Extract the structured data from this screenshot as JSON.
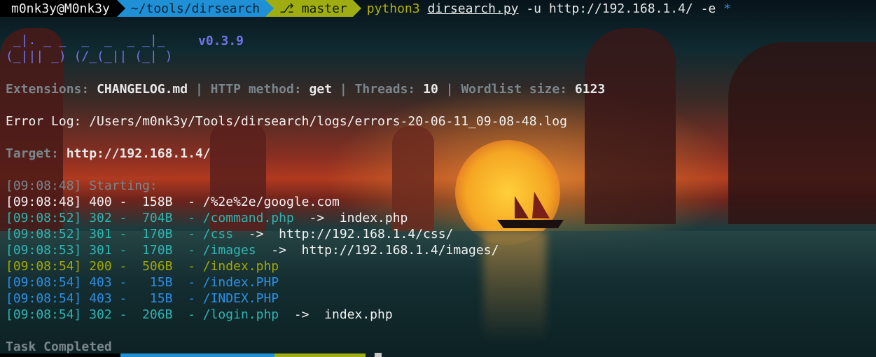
{
  "prompt": {
    "user_host": "m0nk3y@M0nk3y",
    "directory": "~/tools/dirsearch",
    "git_branch": "master",
    "cmd_python": "python3",
    "cmd_script": "dirsearch.py",
    "cmd_args": "-u http://192.168.1.4/ -e",
    "cmd_star": "*"
  },
  "banner": {
    "ascii_line1": " _|. _ _  _  _  _ _|_",
    "ascii_line2": "(_||| _) (/_(_|| (_| )",
    "version": "v0.3.9"
  },
  "config": {
    "ext_label": "Extensions:",
    "ext_value": "CHANGELOG.md",
    "method_label": "HTTP method:",
    "method_value": "get",
    "threads_label": "Threads:",
    "threads_value": "10",
    "wordlist_label": "Wordlist size:",
    "wordlist_value": "6123",
    "separator": "|"
  },
  "error_log": "Error Log: /Users/m0nk3y/Tools/dirsearch/logs/errors-20-06-11_09-08-48.log",
  "target": {
    "label": "Target:",
    "value": "http://192.168.1.4/"
  },
  "starting": "[09:08:48] Starting:",
  "results": [
    {
      "line": "[09:08:48] 400 -  158B  - /%2e%2e/google.com",
      "redirect": "",
      "color": "#f2f2f2"
    },
    {
      "line": "[09:08:52] 302 -  704B  - /command.php",
      "redirect": "  ->  index.php",
      "color": "#2eb5b2"
    },
    {
      "line": "[09:08:52] 301 -  170B  - /css",
      "redirect": "  ->  http://192.168.1.4/css/",
      "color": "#2eb5b2"
    },
    {
      "line": "[09:08:53] 301 -  170B  - /images",
      "redirect": "  ->  http://192.168.1.4/images/",
      "color": "#2eb5b2"
    },
    {
      "line": "[09:08:54] 200 -  506B  - /index.php",
      "redirect": "",
      "color": "#a3a800"
    },
    {
      "line": "[09:08:54] 403 -   15B  - /index.PHP",
      "redirect": "",
      "color": "#2b8fe6"
    },
    {
      "line": "[09:08:54] 403 -   15B  - /INDEX.PHP",
      "redirect": "",
      "color": "#2b8fe6"
    },
    {
      "line": "[09:08:54] 302 -  206B  - /login.php",
      "redirect": "  ->  index.php",
      "color": "#2eb5b2"
    }
  ],
  "task_completed": "Task Completed",
  "colors": {
    "prompt_dir_bg": "#1f8fd6",
    "prompt_git_bg": "#a0ad12",
    "status_200": "#a3a800",
    "status_30x": "#2eb5b2",
    "status_403": "#2b8fe6",
    "status_400": "#f2f2f2"
  }
}
